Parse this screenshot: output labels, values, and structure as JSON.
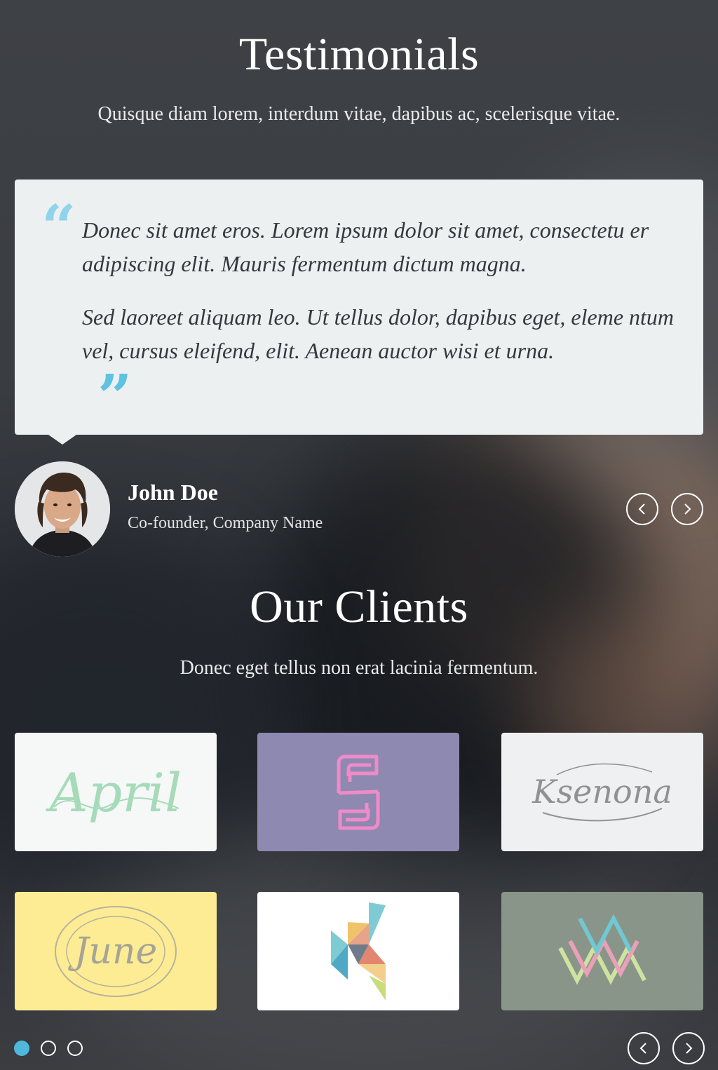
{
  "testimonials": {
    "title": "Testimonials",
    "subtitle": "Quisque diam lorem, interdum vitae, dapibus ac, scelerisque vitae.",
    "quote": {
      "paragraph_1": "Donec sit amet eros. Lorem ipsum dolor sit amet, consectetu er adipiscing elit. Mauris fermentum dictum magna.",
      "paragraph_2": "Sed laoreet aliquam leo. Ut tellus dolor, dapibus eget, eleme ntum vel, cursus eleifend, elit. Aenean auctor wisi et urna.",
      "open_mark": "“",
      "close_mark": "”",
      "quote_color": "#5fc2e0"
    },
    "author": {
      "name": "John Doe",
      "role": "Co-founder, Company Name"
    },
    "nav": {
      "prev_icon": "chevron-left-icon",
      "next_icon": "chevron-right-icon"
    }
  },
  "clients": {
    "title": "Our Clients",
    "subtitle": "Donec eget tellus non erat lacinia fermentum.",
    "logos": [
      {
        "name": "april-logo",
        "background": "#f6f7f7",
        "logo_text": "April",
        "logo_color": "#9fd7b4"
      },
      {
        "name": "s-monogram-logo",
        "background": "#8e89b0",
        "logo_color": "#f083c8"
      },
      {
        "name": "ksenona-logo",
        "background": "#eef0f1",
        "logo_text": "Ksenona",
        "logo_color": "#8a8d90"
      },
      {
        "name": "june-logo",
        "background": "#fdec94",
        "logo_text": "June",
        "logo_color": "#a8a89a"
      },
      {
        "name": "k-origami-logo",
        "background": "#ffffff"
      },
      {
        "name": "w-lines-logo",
        "background": "#8a958a"
      }
    ],
    "pagination": {
      "active_index": 0,
      "total": 3,
      "active_color": "#4fb9dc"
    },
    "nav": {
      "prev_icon": "chevron-left-icon",
      "next_icon": "chevron-right-icon"
    }
  }
}
